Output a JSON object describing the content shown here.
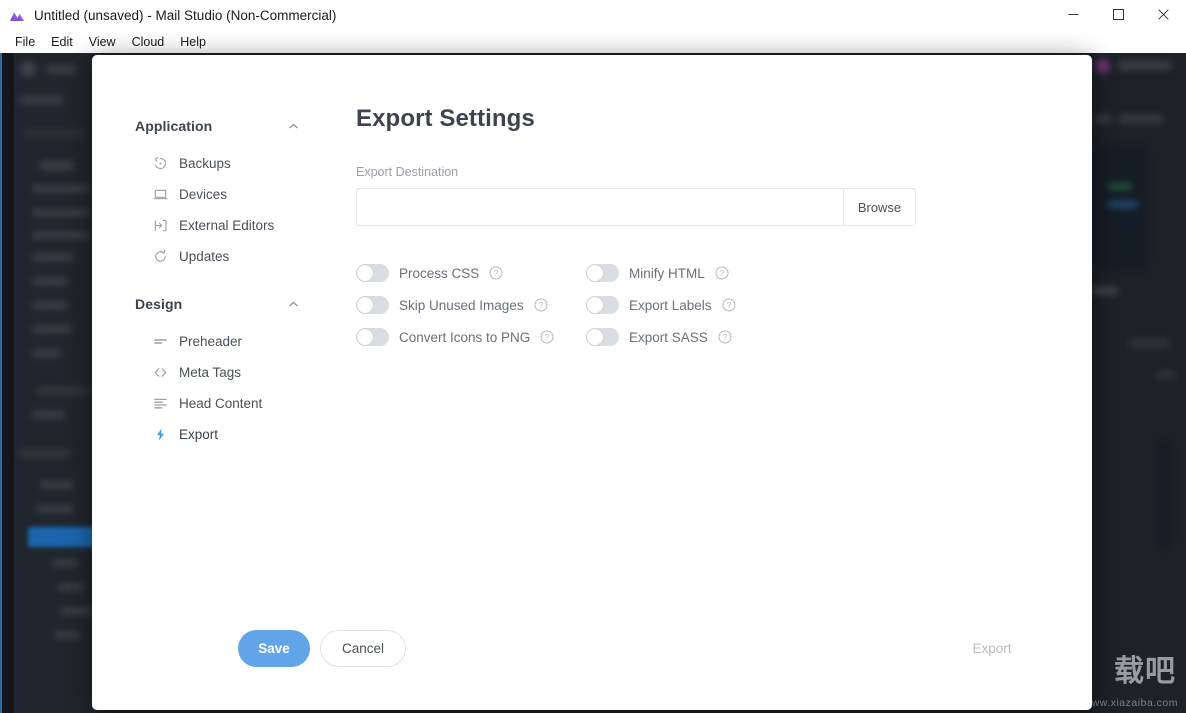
{
  "window": {
    "title": "Untitled (unsaved) - Mail Studio (Non-Commercial)",
    "icon": "mail-studio-logo-icon",
    "controls": {
      "minimize": "minimize-icon",
      "maximize": "maximize-icon",
      "close": "close-icon"
    }
  },
  "menubar": {
    "items": [
      {
        "label": "File"
      },
      {
        "label": "Edit"
      },
      {
        "label": "View"
      },
      {
        "label": "Cloud"
      },
      {
        "label": "Help"
      }
    ]
  },
  "sidebar": {
    "groups": [
      {
        "title": "Application",
        "collapse_icon": "chevron-up-icon",
        "items": [
          {
            "label": "Backups",
            "icon": "restore-icon",
            "active": false
          },
          {
            "label": "Devices",
            "icon": "laptop-icon",
            "active": false
          },
          {
            "label": "External Editors",
            "icon": "arrow-into-box-icon",
            "active": false
          },
          {
            "label": "Updates",
            "icon": "refresh-icon",
            "active": false
          }
        ]
      },
      {
        "title": "Design",
        "collapse_icon": "chevron-up-icon",
        "items": [
          {
            "label": "Preheader",
            "icon": "text-lines-icon",
            "active": false
          },
          {
            "label": "Meta Tags",
            "icon": "code-brackets-icon",
            "active": false
          },
          {
            "label": "Head Content",
            "icon": "list-lines-icon",
            "active": false
          },
          {
            "label": "Export",
            "icon": "lightning-bolt-icon",
            "active": true
          }
        ]
      }
    ]
  },
  "main": {
    "title": "Export Settings",
    "destination": {
      "label": "Export Destination",
      "value": "",
      "placeholder": "",
      "browse_label": "Browse"
    },
    "toggles": [
      {
        "label": "Process CSS",
        "on": false,
        "help": "help-icon"
      },
      {
        "label": "Minify HTML",
        "on": false,
        "help": "help-icon"
      },
      {
        "label": "Skip Unused Images",
        "on": false,
        "help": "help-icon"
      },
      {
        "label": "Export Labels",
        "on": false,
        "help": "help-icon"
      },
      {
        "label": "Convert Icons to PNG",
        "on": false,
        "help": "help-icon"
      },
      {
        "label": "Export SASS",
        "on": false,
        "help": "help-icon"
      }
    ]
  },
  "footer": {
    "save_label": "Save",
    "cancel_label": "Cancel",
    "export_label": "Export"
  },
  "watermark": {
    "cn": "载吧",
    "url": "www.xiazaiba.com"
  },
  "colors": {
    "accent": "#61a5e8",
    "active_nav": "#3d9ae8",
    "toggle_off_track": "#d9dde1",
    "text_primary": "#3d4450",
    "text_secondary": "#6a7078",
    "text_muted": "#9aa0a8",
    "backdrop": "#1b2026"
  }
}
